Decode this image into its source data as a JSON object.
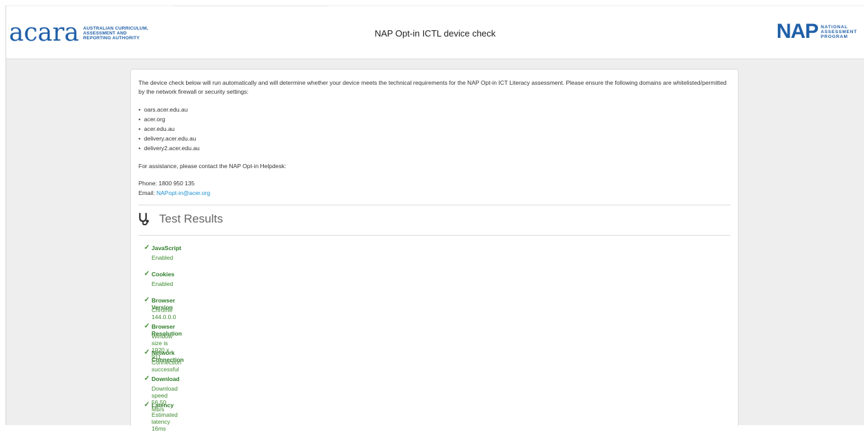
{
  "header": {
    "acara_logo_word": "acara",
    "acara_logo_sub": [
      "AUSTRALIAN CURRICULUM,",
      "ASSESSMENT AND",
      "REPORTING AUTHORITY"
    ],
    "title": "NAP Opt-in ICTL device check",
    "nap_logo_word": "NAP",
    "nap_logo_sub": [
      "NATIONAL",
      "ASSESSMENT",
      "PROGRAM"
    ]
  },
  "intro": {
    "text": "The device check below will run automatically and will determine whether your device meets the technical requirements for the NAP Opt-in ICT Literacy assessment. Please ensure the following domains are whitelisted/permitted by the network firewall or security settings:",
    "domains": [
      "oars.acer.edu.au",
      "acer.org",
      "acer.edu.au",
      "delivery.acer.edu.au",
      "delivery2.acer.edu.au"
    ],
    "assistance": "For assistance, please contact the NAP Opt-in Helpdesk:",
    "phone": "Phone: 1800 950 135",
    "email_label": "Email: ",
    "email_link": "NAPopt-in@acer.org"
  },
  "results": {
    "title": "Test Results",
    "icon": "stethoscope-icon",
    "checks": [
      {
        "name": "JavaScript",
        "status": "Enabled"
      },
      {
        "name": "Cookies",
        "status": "Enabled"
      },
      {
        "name": "Browser Version",
        "status": "Chrome 144.0.0.0"
      },
      {
        "name": "Browser Resolution",
        "status": "Window size is 1920 x 911"
      },
      {
        "name": "Network Connection",
        "status": "Connection successful"
      },
      {
        "name": "Download",
        "status": "Download speed 56.50 Mb/s"
      },
      {
        "name": "Latency",
        "status": "Estimated latency 16ms"
      }
    ],
    "check_icon": "checkmark-icon",
    "success_color": "#3c8a2e"
  },
  "colors": {
    "brand": "#1f5fa8",
    "link": "#1a8fd1",
    "page_bg": "#eeeeee"
  }
}
